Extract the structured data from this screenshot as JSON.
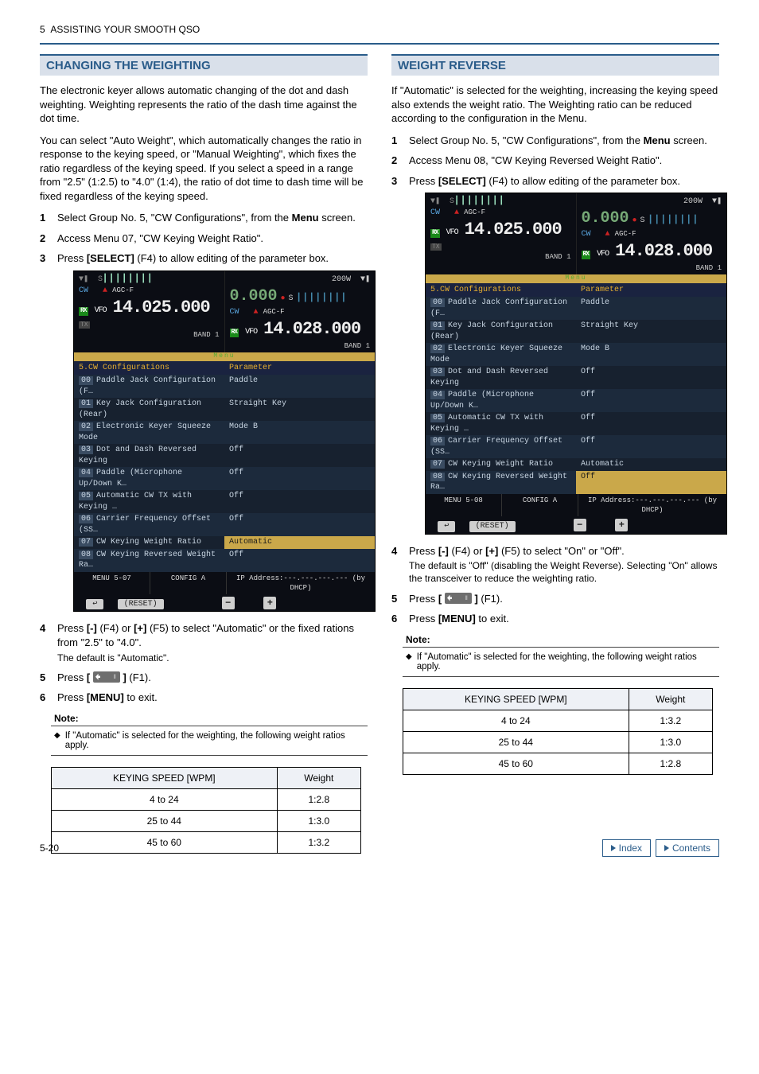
{
  "header": {
    "chapter_num": "5",
    "chapter_title": "ASSISTING YOUR SMOOTH QSO"
  },
  "left": {
    "title": "CHANGING THE WEIGHTING",
    "p1": "The electronic keyer allows automatic changing of the dot and dash weighting. Weighting represents the ratio of the dash time against the dot time.",
    "p2": "You can select \"Auto Weight\", which automatically changes the ratio in response to the keying speed, or \"Manual Weighting\", which fixes the ratio regardless of the keying speed. If you select a speed in a range from \"2.5\" (1:2.5) to \"4.0\" (1:4), the ratio of dot time to dash time will be fixed regardless of the keying speed.",
    "s1a": "Select Group No. 5, \"CW Configurations\", from the ",
    "s1b": "Menu",
    "s1c": " screen.",
    "s2": "Access Menu 07, \"CW Keying Weight Ratio\".",
    "s3a": "Press ",
    "s3b": "[SELECT]",
    "s3c": " (F4) to allow editing of the parameter box.",
    "s4a": "Press ",
    "s4b": "[-]",
    "s4c": " (F4) or ",
    "s4d": "[+]",
    "s4e": " (F5) to select \"Automatic\" or the fixed rations from \"2.5\" to \"4.0\".",
    "s4sub": "The default is \"Automatic\".",
    "s5a": "Press ",
    "s5b": "[",
    "s5c": "]",
    "s5d": " (F1).",
    "s6a": "Press ",
    "s6b": "[MENU]",
    "s6c": " to exit.",
    "note_hdr": "Note:",
    "note_body": "If \"Automatic\" is selected for the weighting, the following weight ratios apply.",
    "th1": "KEYING SPEED [WPM]",
    "th2": "Weight",
    "r1a": "4 to 24",
    "r1b": "1:2.8",
    "r2a": "25 to 44",
    "r2b": "1:3.0",
    "r3a": "45 to 60",
    "r3b": "1:3.2",
    "fig": {
      "w200": "200W",
      "zero": "0.000",
      "cw": "CW",
      "agc": "AGC-F",
      "vfo": "VFO",
      "rx": "RX",
      "tx": "TX",
      "f1": "14.025.000",
      "f2": "14.028.000",
      "b1": "BAND 1",
      "b2": "BAND 1",
      "menulabel": "Menu",
      "gh1": "5.CW Configurations",
      "gh2": "Parameter",
      "rows": [
        {
          "n": "00",
          "k": "Paddle Jack Configuration (F…",
          "v": "Paddle"
        },
        {
          "n": "01",
          "k": "Key Jack Configuration (Rear)",
          "v": "Straight Key"
        },
        {
          "n": "02",
          "k": "Electronic Keyer Squeeze Mode",
          "v": "Mode B"
        },
        {
          "n": "03",
          "k": "Dot and Dash Reversed Keying",
          "v": "Off"
        },
        {
          "n": "04",
          "k": "Paddle (Microphone Up/Down K…",
          "v": "Off"
        },
        {
          "n": "05",
          "k": "Automatic CW TX with Keying …",
          "v": "Off"
        },
        {
          "n": "06",
          "k": "Carrier Frequency Offset (SS…",
          "v": "Off"
        },
        {
          "n": "07",
          "k": "CW Keying Weight Ratio",
          "v": "Automatic"
        },
        {
          "n": "08",
          "k": "CW Keying Reversed Weight Ra…",
          "v": "Off"
        }
      ],
      "m1": "MENU 5-07",
      "m2": "CONFIG A",
      "ip": "IP Address:---.---.---.--- (by DHCP)",
      "reset": "(RESET)",
      "minus": "−",
      "plus": "+"
    }
  },
  "right": {
    "title": "WEIGHT REVERSE",
    "p1": "If \"Automatic\" is selected for the weighting, increasing the keying speed also extends the weight ratio. The Weighting ratio can be reduced according to the configuration in the Menu.",
    "s1a": "Select Group No. 5, \"CW Configurations\", from the ",
    "s1b": "Menu",
    "s1c": " screen.",
    "s2": "Access Menu 08, \"CW Keying Reversed Weight Ratio\".",
    "s3a": "Press ",
    "s3b": "[SELECT]",
    "s3c": " (F4) to allow editing of the parameter box.",
    "s4a": "Press ",
    "s4b": "[-]",
    "s4c": " (F4) or ",
    "s4d": "[+]",
    "s4e": " (F5) to select \"On\" or \"Off\".",
    "s4sub": "The default is \"Off\" (disabling the Weight Reverse). Selecting \"On\" allows the transceiver to reduce the weighting ratio.",
    "s5a": "Press ",
    "s5b": "[",
    "s5c": "]",
    "s5d": " (F1).",
    "s6a": "Press ",
    "s6b": "[MENU]",
    "s6c": " to exit.",
    "note_hdr": "Note:",
    "note_body": "If \"Automatic\" is selected for the weighting, the following weight ratios apply.",
    "th1": "KEYING SPEED [WPM]",
    "th2": "Weight",
    "r1a": "4 to 24",
    "r1b": "1:3.2",
    "r2a": "25 to 44",
    "r2b": "1:3.0",
    "r3a": "45 to 60",
    "r3b": "1:2.8",
    "fig": {
      "w200": "200W",
      "zero": "0.000",
      "cw": "CW",
      "agc": "AGC-F",
      "vfo": "VFO",
      "rx": "RX",
      "tx": "TX",
      "f1": "14.025.000",
      "f2": "14.028.000",
      "b1": "BAND 1",
      "b2": "BAND 1",
      "menulabel": "Menu",
      "gh1": "5.CW Configurations",
      "gh2": "Parameter",
      "rows": [
        {
          "n": "00",
          "k": "Paddle Jack Configuration (F…",
          "v": "Paddle"
        },
        {
          "n": "01",
          "k": "Key Jack Configuration (Rear)",
          "v": "Straight Key"
        },
        {
          "n": "02",
          "k": "Electronic Keyer Squeeze Mode",
          "v": "Mode B"
        },
        {
          "n": "03",
          "k": "Dot and Dash Reversed Keying",
          "v": "Off"
        },
        {
          "n": "04",
          "k": "Paddle (Microphone Up/Down K…",
          "v": "Off"
        },
        {
          "n": "05",
          "k": "Automatic CW TX with Keying …",
          "v": "Off"
        },
        {
          "n": "06",
          "k": "Carrier Frequency Offset (SS…",
          "v": "Off"
        },
        {
          "n": "07",
          "k": "CW Keying Weight Ratio",
          "v": "Automatic"
        },
        {
          "n": "08",
          "k": "CW Keying Reversed Weight Ra…",
          "v": "Off"
        }
      ],
      "m1": "MENU 5-08",
      "m2": "CONFIG A",
      "ip": "IP Address:---.---.---.--- (by DHCP)",
      "reset": "(RESET)",
      "minus": "−",
      "plus": "+"
    }
  },
  "footer": {
    "page": "5-20",
    "index": "Index",
    "contents": "Contents"
  },
  "chart_data": [
    {
      "type": "table",
      "title": "CHANGING THE WEIGHTING — KEYING SPEED vs Weight",
      "columns": [
        "KEYING SPEED [WPM]",
        "Weight"
      ],
      "rows": [
        [
          "4 to 24",
          "1:2.8"
        ],
        [
          "25 to 44",
          "1:3.0"
        ],
        [
          "45 to 60",
          "1:3.2"
        ]
      ]
    },
    {
      "type": "table",
      "title": "WEIGHT REVERSE — KEYING SPEED vs Weight",
      "columns": [
        "KEYING SPEED [WPM]",
        "Weight"
      ],
      "rows": [
        [
          "4 to 24",
          "1:3.2"
        ],
        [
          "25 to 44",
          "1:3.0"
        ],
        [
          "45 to 60",
          "1:2.8"
        ]
      ]
    }
  ]
}
